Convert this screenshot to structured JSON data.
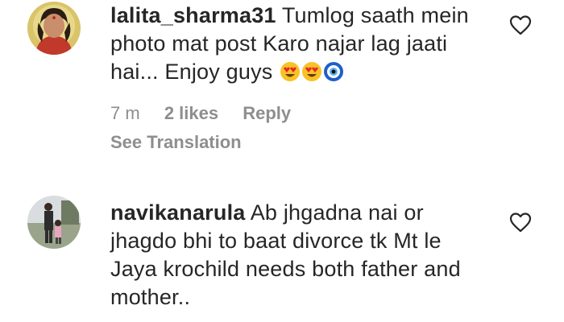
{
  "comments": [
    {
      "username": "lalita_sharma31",
      "text": "Tumlog saath mein photo mat post Karo najar lag jaati hai... Enjoy guys",
      "emojis": [
        "heart-eyes-emoji",
        "heart-eyes-emoji",
        "nazar-amulet-emoji"
      ],
      "time": "7 m",
      "likes": "2 likes",
      "reply": "Reply",
      "translation": "See Translation"
    },
    {
      "username": "navikanarula",
      "text": "Ab jhgadna nai or jhagdo bhi to baat divorce tk Mt le Jaya krochild needs both father and mother.."
    }
  ],
  "icons": {
    "like": "heart-outline-icon"
  },
  "colors": {
    "text": "#262626",
    "meta": "#8e8e8e",
    "background": "#ffffff"
  }
}
